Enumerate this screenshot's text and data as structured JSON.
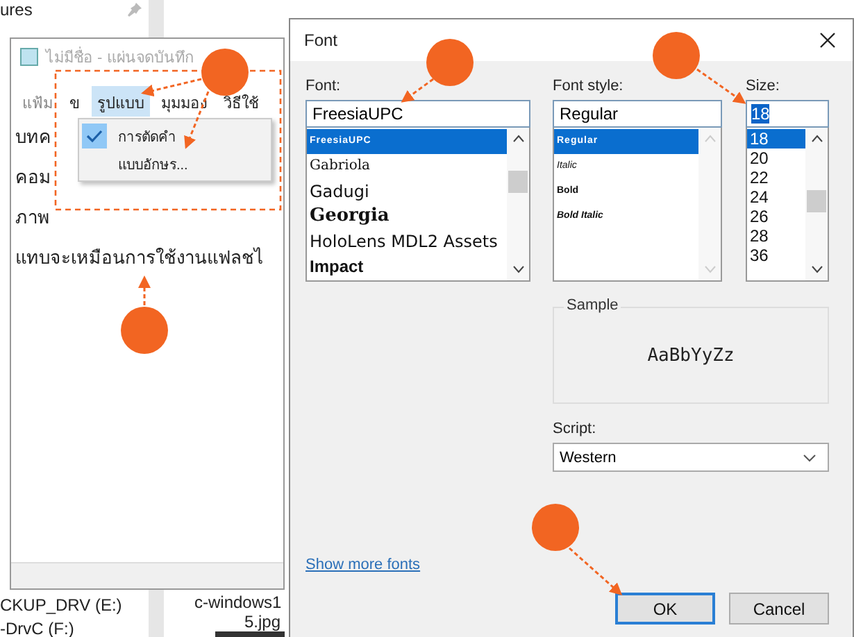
{
  "explorer": {
    "items": [
      "ures",
      "CKUP_DRV (E:)",
      "-DrvC (F:)"
    ],
    "file_name": [
      "c-windows1",
      "5.jpg"
    ]
  },
  "notepad": {
    "title": "ไม่มีชื่อ - แผ่นจดบันทึก",
    "menu": [
      {
        "label": "แฟ้ม",
        "selected": false
      },
      {
        "label": "ข",
        "selected": false
      },
      {
        "label": "รูปแบบ",
        "selected": true
      },
      {
        "label": "มุมมอง",
        "selected": false
      },
      {
        "label": "วิธีใช้",
        "selected": false
      }
    ],
    "dropdown": [
      {
        "label": "การตัดคำ",
        "checked": true
      },
      {
        "label": "แบบอักษร...",
        "checked": false
      }
    ],
    "lines": [
      "บทค",
      "คอม",
      "ภาพ",
      "แทบจะเหมือนการใช้งานแฟลชไ"
    ]
  },
  "font_dialog": {
    "title": "Font",
    "font": {
      "label": "Font:",
      "value": "FreesiaUPC",
      "items": [
        {
          "label": "FreesiaUPC",
          "kind": "tiny",
          "selected": true
        },
        {
          "label": "Gabriola",
          "kind": "script",
          "selected": false
        },
        {
          "label": "Gadugi",
          "kind": "sans",
          "selected": false
        },
        {
          "label": "Georgia",
          "kind": "serif",
          "selected": false
        },
        {
          "label": "HoloLens MDL2 Assets",
          "kind": "sans",
          "selected": false
        },
        {
          "label": "Impact",
          "kind": "heavy",
          "selected": false
        }
      ]
    },
    "style": {
      "label": "Font style:",
      "value": "Regular",
      "items": [
        {
          "label": "Regular",
          "kind": "regular",
          "selected": true
        },
        {
          "label": "Italic",
          "kind": "italic",
          "selected": false
        },
        {
          "label": "Bold",
          "kind": "bold",
          "selected": false
        },
        {
          "label": "Bold Italic",
          "kind": "bolditalic",
          "selected": false
        }
      ]
    },
    "size": {
      "label": "Size:",
      "value": "18",
      "items": [
        {
          "label": "18",
          "selected": true
        },
        {
          "label": "20",
          "selected": false
        },
        {
          "label": "22",
          "selected": false
        },
        {
          "label": "24",
          "selected": false
        },
        {
          "label": "26",
          "selected": false
        },
        {
          "label": "28",
          "selected": false
        },
        {
          "label": "36",
          "selected": false
        }
      ]
    },
    "sample": {
      "label": "Sample",
      "text": "AaBbYyZz"
    },
    "script": {
      "label": "Script:",
      "value": "Western"
    },
    "link": "Show more fonts",
    "buttons": [
      "OK",
      "Cancel"
    ]
  }
}
